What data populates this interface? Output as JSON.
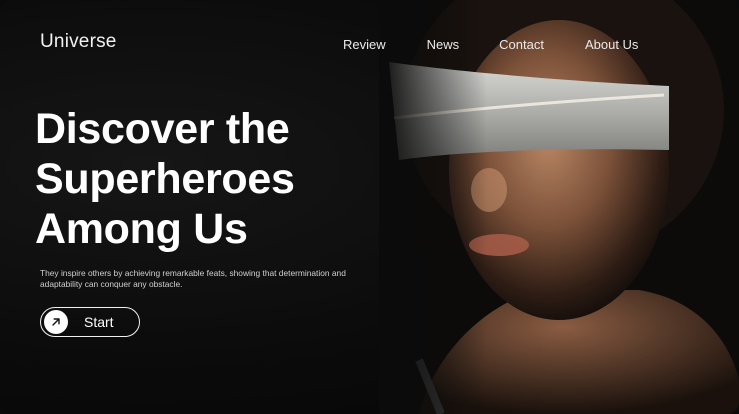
{
  "brand": {
    "name": "Universe"
  },
  "nav": {
    "items": [
      {
        "label": "Review"
      },
      {
        "label": "News"
      },
      {
        "label": "Contact"
      },
      {
        "label": "About Us"
      }
    ]
  },
  "hero": {
    "headline_lines": [
      "Discover the",
      "Superheroes",
      "Among Us"
    ],
    "description": "They inspire others by achieving remarkable feats, showing that determination and adaptability can conquer any obstacle.",
    "cta": {
      "label": "Start",
      "icon": "arrow-up-right-icon"
    },
    "image": "portrait-blindfolded-woman"
  },
  "colors": {
    "background": "#0b0b0b",
    "text": "#ffffff",
    "muted_text": "#d0d0d0",
    "blindfold": "#bdbdbd"
  }
}
